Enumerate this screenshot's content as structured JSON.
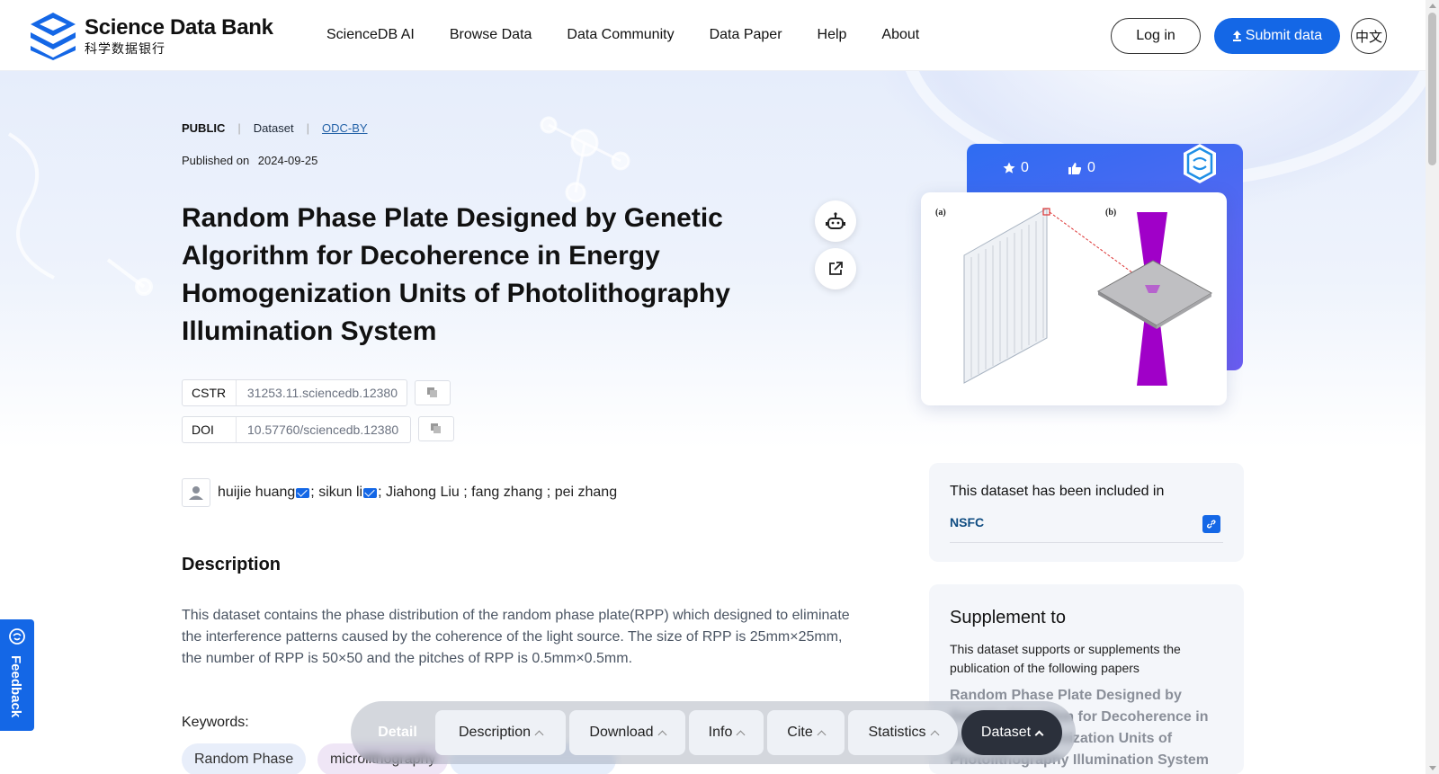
{
  "brand": {
    "name_en": "Science Data Bank",
    "name_cn": "科学数据银行",
    "color": "#1467e6"
  },
  "nav": {
    "items": [
      {
        "label": "ScienceDB AI"
      },
      {
        "label": "Browse Data"
      },
      {
        "label": "Data Community"
      },
      {
        "label": "Data Paper"
      },
      {
        "label": "Help"
      },
      {
        "label": "About"
      }
    ],
    "login": "Log in",
    "submit": "Submit data",
    "lang": "中文"
  },
  "dataset": {
    "access": "PUBLIC",
    "type": "Dataset",
    "license": "ODC-BY",
    "published_label": "Published on",
    "published_date": "2024-09-25",
    "title": "Random Phase Plate Designed by Genetic Algorithm for Decoherence in Energy Homogenization Units of Photolithography Illumination System",
    "cstr_label": "CSTR",
    "cstr": "31253.11.sciencedb.12380",
    "doi_label": "DOI",
    "doi": "10.57760/sciencedb.12380",
    "authors": [
      {
        "name": "huijie huang",
        "email": true
      },
      {
        "name": "sikun li",
        "email": true
      },
      {
        "name": "Jiahong Liu",
        "email": false
      },
      {
        "name": "fang zhang",
        "email": false
      },
      {
        "name": "pei zhang",
        "email": false
      }
    ],
    "stars": "0",
    "likes": "0"
  },
  "description": {
    "heading": "Description",
    "text": "This dataset contains the phase distribution of the random phase plate(RPP) which designed to eliminate the interference patterns caused by the coherence of the light source. The size of RPP is 25mm×25mm, the number of RPP is 50×50 and the pitches of RPP is 0.5mm×0.5mm."
  },
  "keywords": {
    "label": "Keywords:",
    "items": [
      "Random Phase",
      "microlithography"
    ]
  },
  "included": {
    "title": "This dataset has been included in",
    "item": "NSFC"
  },
  "supplement": {
    "heading": "Supplement to",
    "text": "This dataset supports or supplements the publication of the following papers",
    "paper": "Random Phase Plate Designed by Genetic Algorithm for Decoherence in Energy Homogenization Units of Photolithography Illumination System"
  },
  "preview": {
    "label_a": "(a)",
    "label_b": "(b)"
  },
  "feedback": "Feedback",
  "bottom_bar": {
    "detail": "Detail",
    "items": [
      "Description",
      "Download",
      "Info",
      "Cite",
      "Statistics"
    ],
    "active": "Dataset"
  }
}
